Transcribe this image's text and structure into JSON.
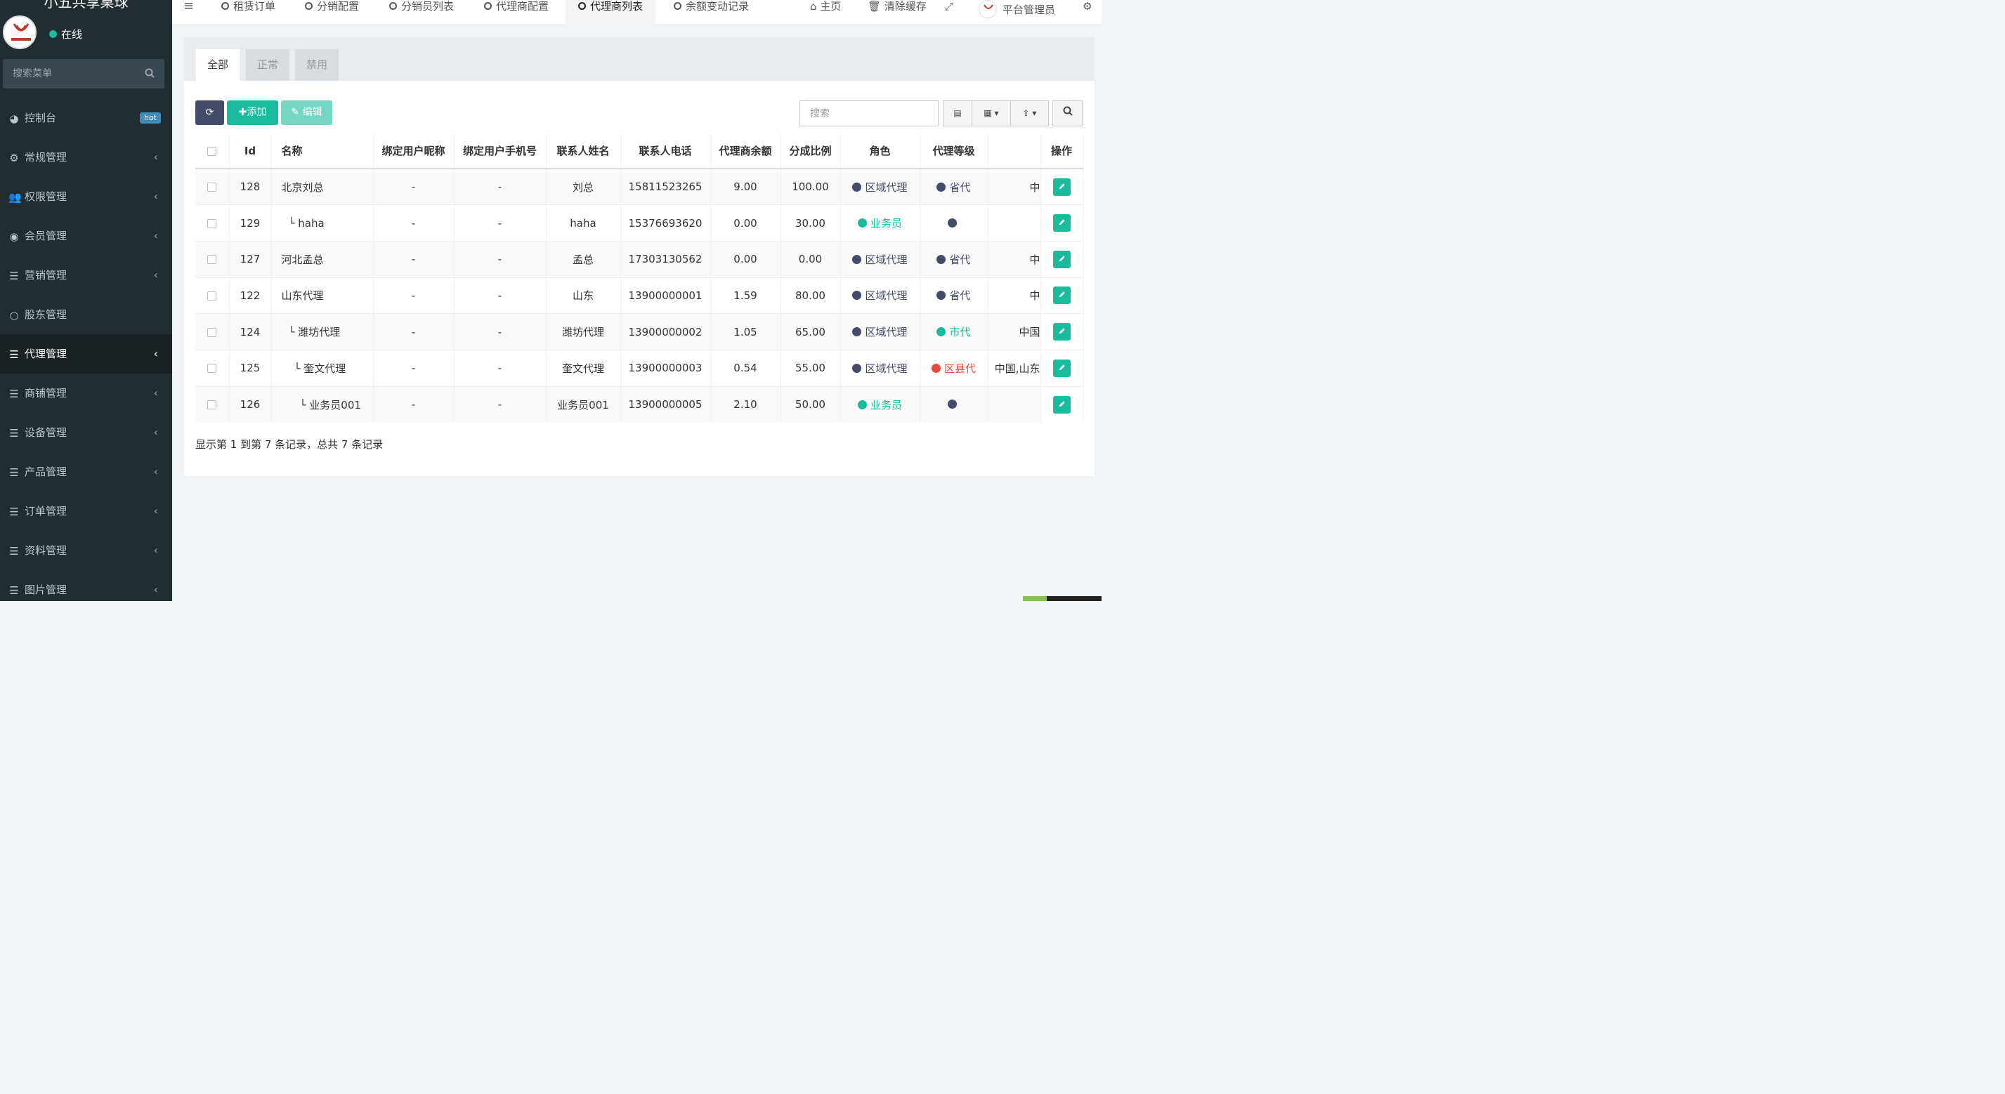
{
  "app": {
    "title": "小五共享桌球"
  },
  "user": {
    "status": "在线"
  },
  "menu_search": {
    "placeholder": "搜索菜单"
  },
  "menu": [
    {
      "label": "控制台",
      "icon": "dashboard-icon",
      "badge": "hot"
    },
    {
      "label": "常规管理",
      "icon": "cogs-icon"
    },
    {
      "label": "权限管理",
      "icon": "group-icon"
    },
    {
      "label": "会员管理",
      "icon": "user-circle-icon"
    },
    {
      "label": "营销管理",
      "icon": "list-icon"
    },
    {
      "label": "股东管理",
      "icon": "circle-icon"
    },
    {
      "label": "代理管理",
      "icon": "list-icon",
      "active": true
    },
    {
      "label": "商铺管理",
      "icon": "list-icon"
    },
    {
      "label": "设备管理",
      "icon": "list-icon"
    },
    {
      "label": "产品管理",
      "icon": "list-icon"
    },
    {
      "label": "订单管理",
      "icon": "list-icon"
    },
    {
      "label": "资料管理",
      "icon": "list-icon"
    },
    {
      "label": "图片管理",
      "icon": "list-icon"
    }
  ],
  "top_tabs": [
    {
      "label": "租赁订单"
    },
    {
      "label": "分销配置"
    },
    {
      "label": "分销员列表"
    },
    {
      "label": "代理商配置"
    },
    {
      "label": "代理商列表",
      "active": true
    },
    {
      "label": "余额变动记录"
    }
  ],
  "top_nav": {
    "home": "主页",
    "clear_cache": "清除缓存",
    "admin": "平台管理员"
  },
  "filter_tabs": [
    "全部",
    "正常",
    "禁用"
  ],
  "toolbar": {
    "add": "添加",
    "edit": "编辑",
    "search_placeholder": "搜索"
  },
  "table": {
    "headers": [
      "Id",
      "名称",
      "绑定用户昵称",
      "绑定用户手机号",
      "联系人姓名",
      "联系人电话",
      "代理商余额",
      "分成比例",
      "角色",
      "代理等级",
      "",
      "操作"
    ],
    "rows": [
      {
        "id": "128",
        "name": "北京刘总",
        "nick": "-",
        "phone": "-",
        "contact": "刘总",
        "tel": "15811523265",
        "balance": "9.00",
        "ratio": "100.00",
        "role": "区域代理",
        "role_color": "navy",
        "level": "省代",
        "level_color": "navy",
        "region": "中"
      },
      {
        "id": "129",
        "name": "└ haha",
        "nick": "-",
        "phone": "-",
        "contact": "haha",
        "tel": "15376693620",
        "balance": "0.00",
        "ratio": "30.00",
        "role": "业务员",
        "role_color": "green",
        "level": "",
        "level_color": "navy",
        "region": ""
      },
      {
        "id": "127",
        "name": "河北孟总",
        "nick": "-",
        "phone": "-",
        "contact": "孟总",
        "tel": "17303130562",
        "balance": "0.00",
        "ratio": "0.00",
        "role": "区域代理",
        "role_color": "navy",
        "level": "省代",
        "level_color": "navy",
        "region": "中"
      },
      {
        "id": "122",
        "name": "山东代理",
        "nick": "-",
        "phone": "-",
        "contact": "山东",
        "tel": "13900000001",
        "balance": "1.59",
        "ratio": "80.00",
        "role": "区域代理",
        "role_color": "navy",
        "level": "省代",
        "level_color": "navy",
        "region": "中"
      },
      {
        "id": "124",
        "name": "└ 潍坊代理",
        "nick": "-",
        "phone": "-",
        "contact": "潍坊代理",
        "tel": "13900000002",
        "balance": "1.05",
        "ratio": "65.00",
        "role": "区域代理",
        "role_color": "navy",
        "level": "市代",
        "level_color": "green",
        "region": "中国"
      },
      {
        "id": "125",
        "name": "└ 奎文代理",
        "nick": "-",
        "phone": "-",
        "contact": "奎文代理",
        "tel": "13900000003",
        "balance": "0.54",
        "ratio": "55.00",
        "role": "区域代理",
        "role_color": "navy",
        "level": "区县代",
        "level_color": "red",
        "region": "中国,山东"
      },
      {
        "id": "126",
        "name": "└ 业务员001",
        "nick": "-",
        "phone": "-",
        "contact": "业务员001",
        "tel": "13900000005",
        "balance": "2.10",
        "ratio": "50.00",
        "role": "业务员",
        "role_color": "green",
        "level": "",
        "level_color": "navy",
        "region": ""
      }
    ]
  },
  "pagination": {
    "summary": "显示第 1 到第 7 条记录，总共 7 条记录"
  }
}
